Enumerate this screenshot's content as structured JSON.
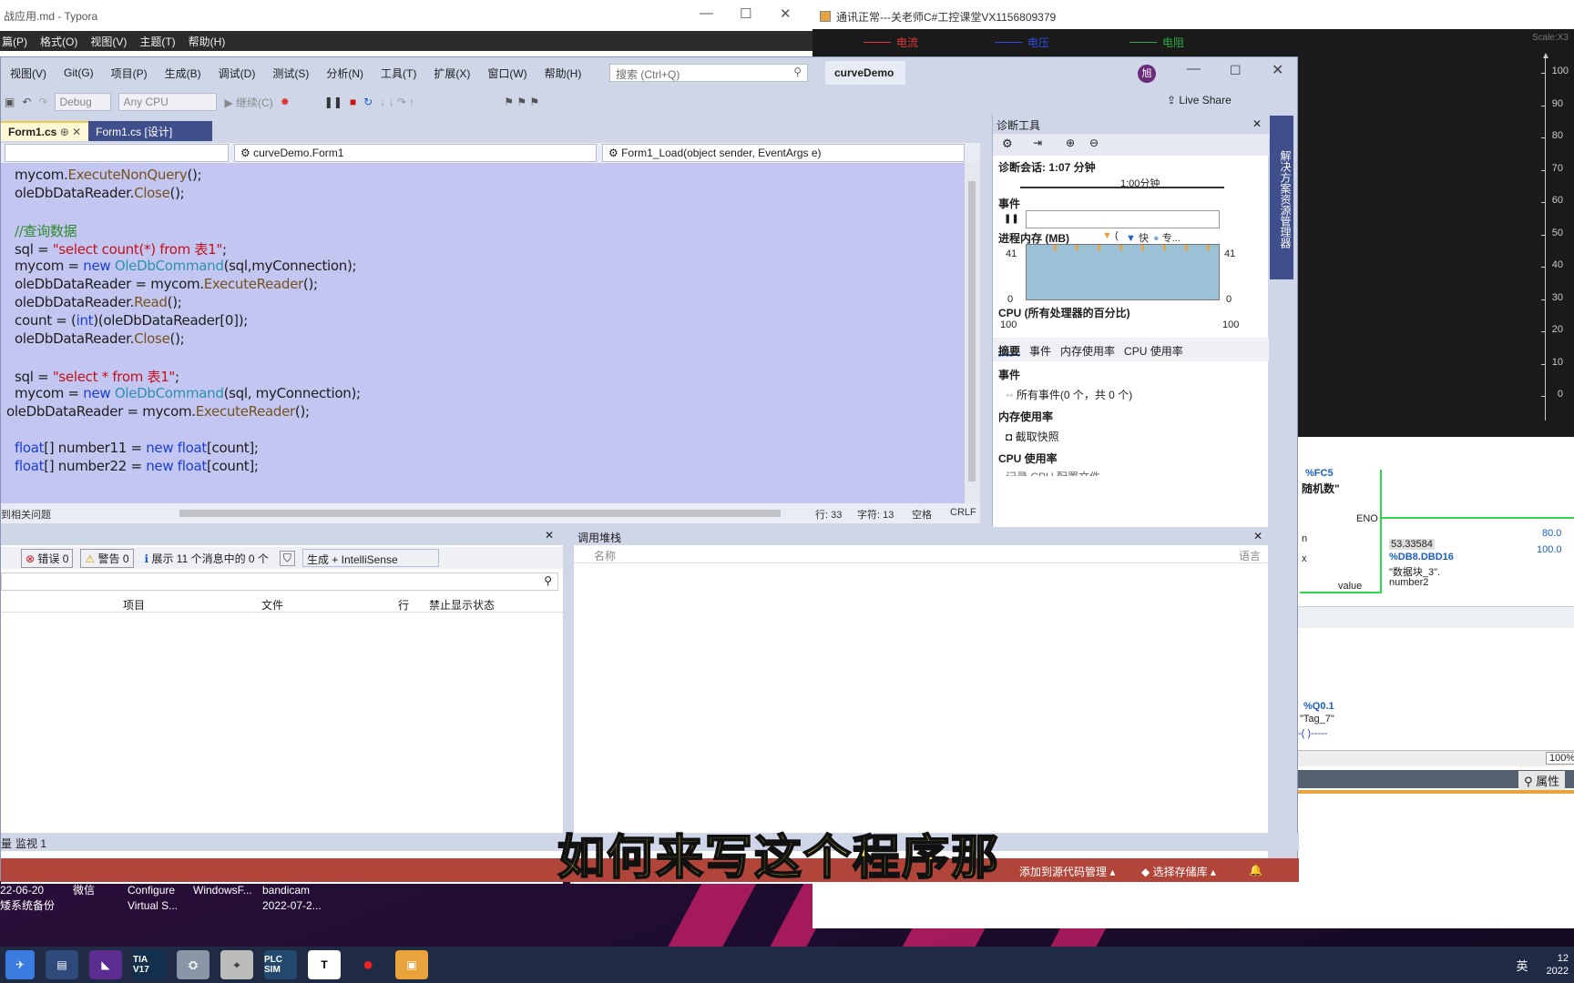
{
  "typora": {
    "title": "战应用.md - Typora",
    "menu": [
      "篇(P)",
      "格式(O)",
      "视图(V)",
      "主题(T)",
      "帮助(H)"
    ]
  },
  "plc": {
    "title": "通讯正常---关老师C#工控课堂VX1156809379",
    "legend": [
      "电流",
      "电压",
      "电阻"
    ],
    "scale": "Scale:X3",
    "yticks": [
      "100",
      "90",
      "80",
      "70",
      "60",
      "50",
      "40",
      "30",
      "20",
      "10",
      "0"
    ],
    "fc": "%FC5",
    "block_name": "随机数\"",
    "eno": "ENO",
    "value_label": "value",
    "val1": "53.33584",
    "db": "%DB8.DBD16",
    "db_name": "\"数据块_3\".",
    "number2": "number2",
    "right_vals": [
      "80.0",
      "100.0"
    ],
    "q": "%Q0.1",
    "tag": "\"Tag_7\"",
    "zoom": "100%",
    "props": "属性",
    "pin_n": "n",
    "pin_x": "x"
  },
  "vs": {
    "menu": [
      "视图(V)",
      "Git(G)",
      "项目(P)",
      "生成(B)",
      "调试(D)",
      "测试(S)",
      "分析(N)",
      "工具(T)",
      "扩展(X)",
      "窗口(W)",
      "帮助(H)"
    ],
    "search_placeholder": "搜索 (Ctrl+Q)",
    "solution": "curveDemo",
    "avatar": "旭",
    "live_share": "Live Share",
    "toolbar": {
      "config": "Debug",
      "platform": "Any CPU",
      "continue": "继续(C)"
    },
    "tabs": [
      {
        "label": "Form1.cs"
      },
      {
        "label": "Form1.cs [设计]"
      }
    ],
    "nav": {
      "class": "curveDemo.Form1",
      "member": "Form1_Load(object sender, EventArgs e)"
    },
    "code": [
      {
        "t": "mycom.ExecuteNonQuery();"
      },
      {
        "t": "oleDbDataReader.Close();"
      },
      {
        "t": ""
      },
      {
        "t": "//查询数据"
      },
      {
        "t": "sql = \"select count(*) from 表1\";"
      },
      {
        "t": "mycom = new OleDbCommand(sql,myConnection);"
      },
      {
        "t": "oleDbDataReader = mycom.ExecuteReader();"
      },
      {
        "t": "oleDbDataReader.Read();"
      },
      {
        "t": "count = (int)(oleDbDataReader[0]);"
      },
      {
        "t": "oleDbDataReader.Close();"
      },
      {
        "t": ""
      },
      {
        "t": "sql = \"select * from 表1\";"
      },
      {
        "t": "mycom = new OleDbCommand(sql, myConnection);"
      },
      {
        "t": "oleDbDataReader = mycom.ExecuteReader();"
      },
      {
        "t": ""
      },
      {
        "t": "float[] number11 = new float[count];"
      },
      {
        "t": "float[] number22 = new float[count];"
      }
    ],
    "status": {
      "issues": "到相关问题",
      "line": "行: 33",
      "col": "字符: 13",
      "space": "空格",
      "eol": "CRLF"
    },
    "side_tab": "解决方案资源管理器"
  },
  "diag": {
    "title": "诊断工具",
    "session": "诊断会话: 1:07 分钟",
    "timeline": "1:00分钟",
    "events": "事件",
    "memory": "进程内存 (MB)",
    "mem_max": "41",
    "mem_min": "0",
    "mem_legend": [
      "(",
      "快",
      "专..."
    ],
    "cpu": "CPU (所有处理器的百分比)",
    "cpu_max": "100",
    "tabs": [
      "摘要",
      "事件",
      "内存使用率",
      "CPU 使用率"
    ],
    "sec_events": "事件",
    "all_events": "所有事件(0 个，共 0 个)",
    "sec_mem": "内存使用率",
    "snapshot": "截取快照",
    "sec_cpu": "CPU 使用率",
    "cpu_record": "记录 CPU 配置文件"
  },
  "errors": {
    "errors": "错误 0",
    "warnings": "警告 0",
    "messages": "展示 11 个消息中的 0 个",
    "build": "生成 + IntelliSense",
    "cols": [
      "项目",
      "文件",
      "行",
      "禁止显示状态"
    ]
  },
  "callstack": {
    "title": "调用堆栈",
    "col_name": "名称",
    "col_lang": "语言"
  },
  "bottom_tabs": [
    "量",
    "监视 1"
  ],
  "vs_status": {
    "git": "添加到源代码管理",
    "repo": "选择存储库"
  },
  "desktop": [
    {
      "a": "22-06-20",
      "b": "矮系统备份"
    },
    {
      "a": "微信",
      "b": ""
    },
    {
      "a": "Configure",
      "b": "Virtual S..."
    },
    {
      "a": "WindowsF...",
      "b": ""
    },
    {
      "a": "bandicam",
      "b": "2022-07-2..."
    }
  ],
  "taskbar": {
    "tia": "TIA V17",
    "plcsim": "PLC SIM",
    "t": "T",
    "ime": "英",
    "clock_t": "12",
    "clock_d": "2022"
  },
  "subtitle": "如何来写这个程序那"
}
